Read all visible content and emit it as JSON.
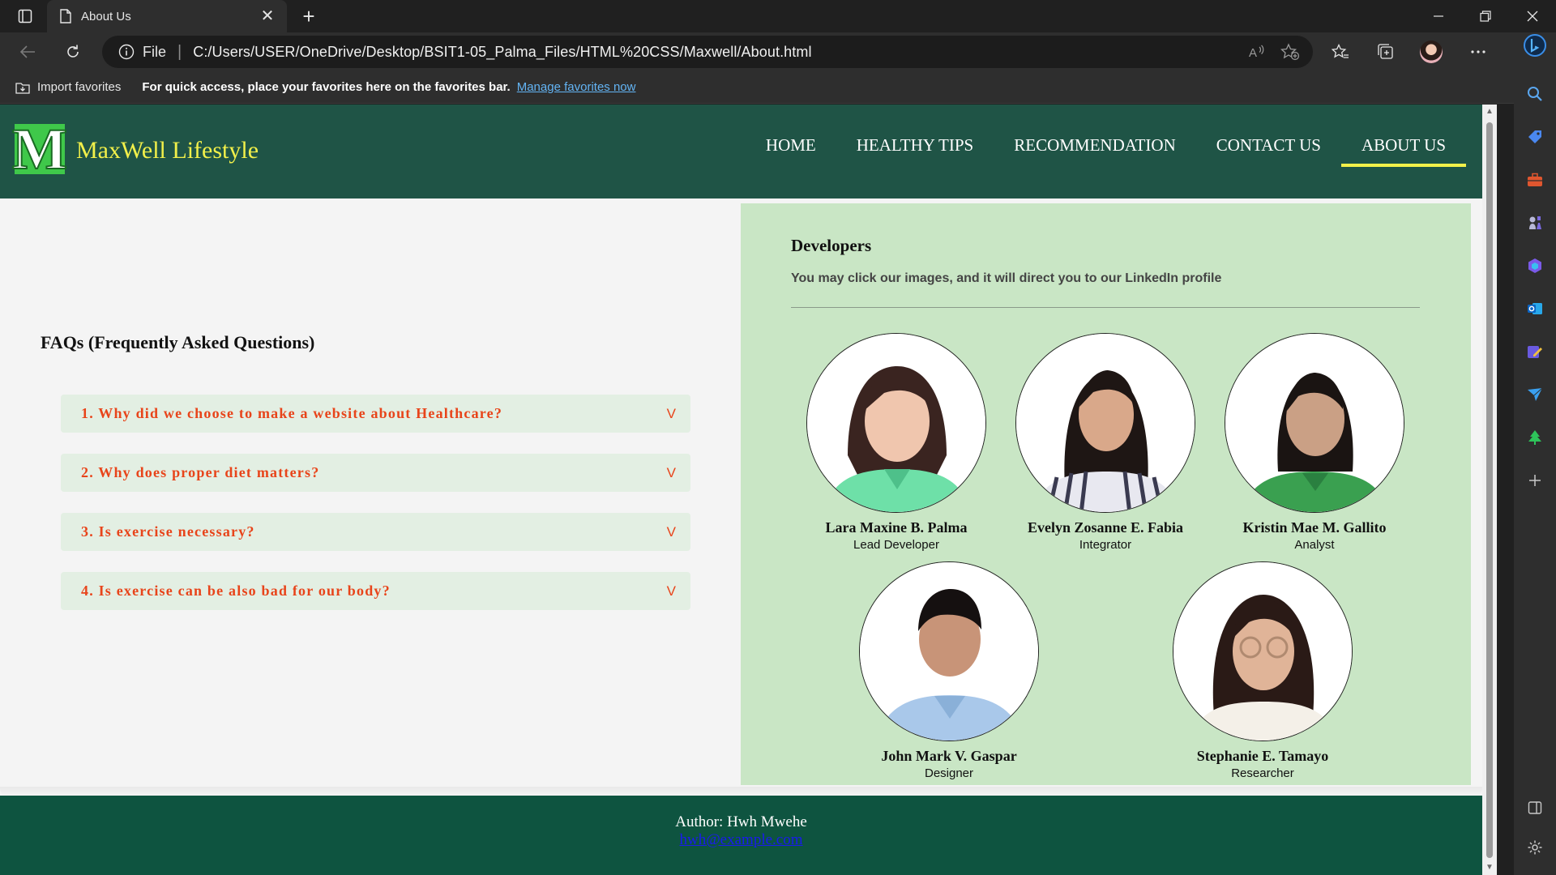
{
  "browser": {
    "tab_title": "About Us",
    "address_scheme": "File",
    "address_url": "C:/Users/USER/OneDrive/Desktop/BSIT1-05_Palma_Files/HTML%20CSS/Maxwell/About.html",
    "favorites_bar": {
      "import_label": "Import favorites",
      "hint": "For quick access, place your favorites here on the favorites bar.",
      "manage_link": "Manage favorites now"
    }
  },
  "site": {
    "logo_letter": "M",
    "brand": "MaxWell Lifestyle",
    "nav": [
      {
        "label": "HOME"
      },
      {
        "label": "HEALTHY TIPS"
      },
      {
        "label": "RECOMMENDATION"
      },
      {
        "label": "CONTACT US"
      },
      {
        "label": "ABOUT US",
        "active": true
      }
    ],
    "accent_color": "#f2f04a",
    "header_color": "#1f5446"
  },
  "faq": {
    "title": "FAQs (Frequently Asked Questions)",
    "items": [
      {
        "question": "1. Why did we choose to make a website about Healthcare?",
        "chevron": "V"
      },
      {
        "question": "2. Why does proper diet matters?",
        "chevron": "V"
      },
      {
        "question": "3. Is exercise necessary?",
        "chevron": "V"
      },
      {
        "question": "4. Is exercise can be also bad for our body?",
        "chevron": "V"
      }
    ]
  },
  "developers": {
    "title": "Developers",
    "subtitle": "You may click our images, and it will direct you to our LinkedIn profile",
    "members": [
      {
        "name": "Lara Maxine B. Palma",
        "role": "Lead Developer"
      },
      {
        "name": "Evelyn Zosanne E. Fabia",
        "role": "Integrator"
      },
      {
        "name": "Kristin Mae M. Gallito",
        "role": "Analyst"
      },
      {
        "name": "John Mark V. Gaspar",
        "role": "Designer"
      },
      {
        "name": "Stephanie E. Tamayo",
        "role": "Researcher"
      }
    ]
  },
  "footer": {
    "author": "Author: Hwh Mwehe",
    "email": "hwh@example.com"
  }
}
